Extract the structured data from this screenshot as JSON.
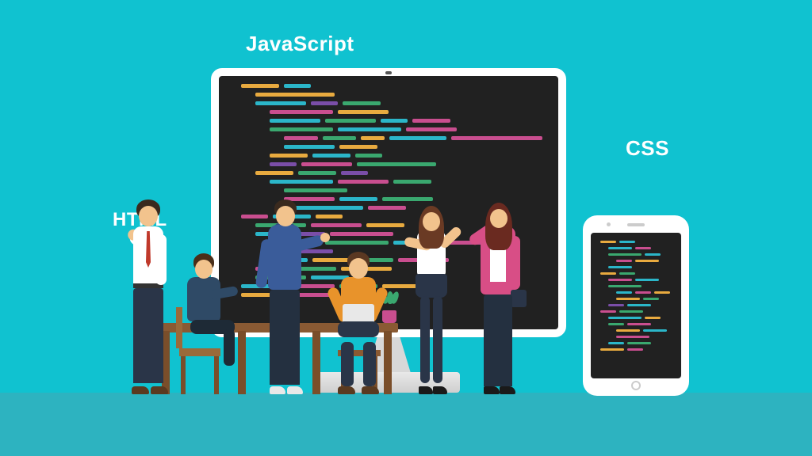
{
  "labels": {
    "javascript": "JavaScript",
    "css": "CSS",
    "html": "HTML"
  },
  "scene": {
    "monitor_alt": "Desktop monitor showing colorful code editor",
    "phone_alt": "Smartphone showing colorful code editor",
    "colors": {
      "background": "#10c2d0",
      "floor": "#2db3c0",
      "code_cyan": "#2bb6c9",
      "code_orange": "#e8aa3f",
      "code_pink": "#c94e8f",
      "code_green": "#3aa86f",
      "code_purple": "#7a4ea8"
    }
  }
}
